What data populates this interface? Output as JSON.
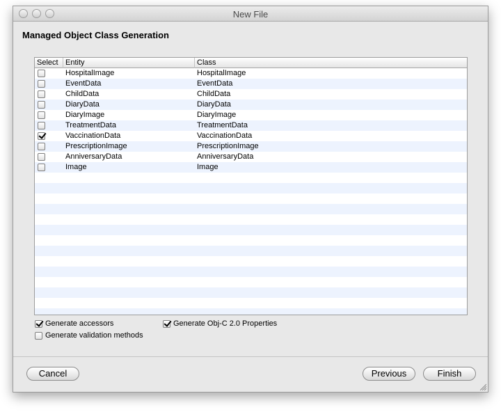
{
  "window": {
    "title": "New File"
  },
  "page": {
    "heading": "Managed Object Class Generation"
  },
  "table": {
    "columns": {
      "select": "Select",
      "entity": "Entity",
      "class": "Class"
    },
    "rows": [
      {
        "entity": "HospitalImage",
        "class": "HospitalImage",
        "checked": false
      },
      {
        "entity": "EventData",
        "class": "EventData",
        "checked": false
      },
      {
        "entity": "ChildData",
        "class": "ChildData",
        "checked": false
      },
      {
        "entity": "DiaryData",
        "class": "DiaryData",
        "checked": false
      },
      {
        "entity": "DiaryImage",
        "class": "DiaryImage",
        "checked": false
      },
      {
        "entity": "TreatmentData",
        "class": "TreatmentData",
        "checked": false
      },
      {
        "entity": "VaccinationData",
        "class": "VaccinationData",
        "checked": true
      },
      {
        "entity": "PrescriptionImage",
        "class": "PrescriptionImage",
        "checked": false
      },
      {
        "entity": "AnniversaryData",
        "class": "AnniversaryData",
        "checked": false
      },
      {
        "entity": "Image",
        "class": "Image",
        "checked": false
      }
    ]
  },
  "options": {
    "generate_accessors": {
      "label": "Generate accessors",
      "checked": true
    },
    "generate_validation": {
      "label": "Generate validation methods",
      "checked": false
    },
    "generate_objc_properties": {
      "label": "Generate Obj-C 2.0 Properties",
      "checked": true
    }
  },
  "buttons": {
    "cancel": "Cancel",
    "previous": "Previous",
    "finish": "Finish"
  }
}
